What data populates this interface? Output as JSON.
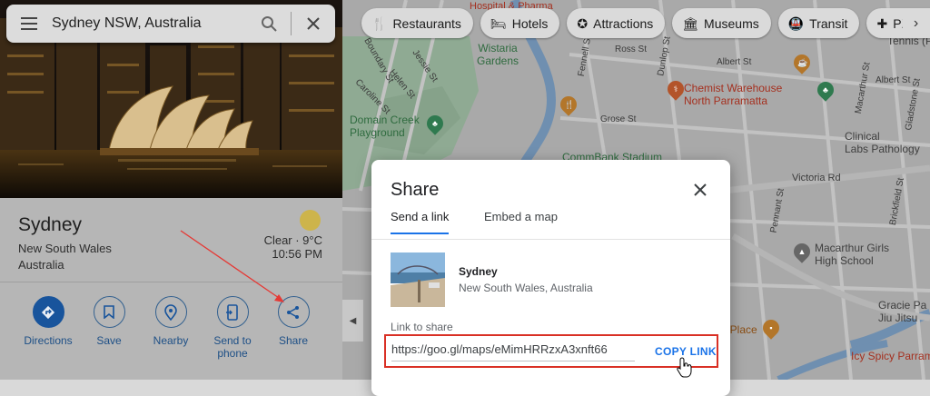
{
  "search": {
    "query": "Sydney NSW, Australia",
    "menu_icon": "hamburger-icon",
    "search_icon": "search-icon",
    "close_icon": "close-icon"
  },
  "place": {
    "name": "Sydney",
    "region": "New South Wales",
    "country": "Australia",
    "weather": "Clear · 9°C",
    "time": "10:56 PM"
  },
  "actions": [
    {
      "label": "Directions",
      "icon": "directions-icon"
    },
    {
      "label": "Save",
      "icon": "bookmark-icon"
    },
    {
      "label": "Nearby",
      "icon": "nearby-icon"
    },
    {
      "label_line1": "Send to",
      "label_line2": "phone",
      "icon": "send-to-phone-icon"
    },
    {
      "label": "Share",
      "icon": "share-icon"
    }
  ],
  "chips": [
    {
      "label": "Restaurants",
      "icon": "restaurant-icon"
    },
    {
      "label": "Hotels",
      "icon": "hotel-icon"
    },
    {
      "label": "Attractions",
      "icon": "attractions-icon"
    },
    {
      "label": "Museums",
      "icon": "museum-icon"
    },
    {
      "label": "Transit",
      "icon": "transit-icon"
    },
    {
      "label": "Pharma",
      "icon": "pharmacy-icon"
    }
  ],
  "map_labels": {
    "wistaria": "Wistaria\nGardens",
    "chemist": "Chemist Warehouse\nNorth Parramatta",
    "domain_creek": "Domain Creek\nPlayground",
    "commbank": "CommBank Stadium",
    "victoria_rd": "Victoria Rd",
    "albert_st": "Albert St",
    "albert_st_2": "Albert St",
    "grose_st": "Grose St",
    "jessie_st": "Jessie St",
    "helen_st": "Helen St",
    "caroline_st": "Caroline St",
    "boundary_st": "Boundary St",
    "tennis": "Tennis (P",
    "clinical": "Clinical\nLabs Pathology",
    "macarthur": "Macarthur Girls\nHigh School",
    "gracie": "Gracie Pa\nJiu Jitsu",
    "icy": "Icy Spicy Parram",
    "on_place": "on Place",
    "hospital": "Hospital & Pharma",
    "macarthur_st": "Macarthur St",
    "pennant": "Pennant St",
    "fennell": "Fennell St",
    "dunlop": "Dunlop St",
    "gladstone": "Gladstone St",
    "ross": "Ross St",
    "brickfield": "Brickfield St"
  },
  "share_dialog": {
    "title": "Share",
    "tab_send": "Send a link",
    "tab_embed": "Embed a map",
    "place_name": "Sydney",
    "place_addr": "New South Wales, Australia",
    "link_label": "Link to share",
    "link": "https://goo.gl/maps/eMimHRRzxA3xnft66",
    "copy_label": "COPY LINK"
  },
  "colors": {
    "accent": "#1a73e8",
    "highlight_box": "#d93025",
    "arrow": "#e53935"
  }
}
